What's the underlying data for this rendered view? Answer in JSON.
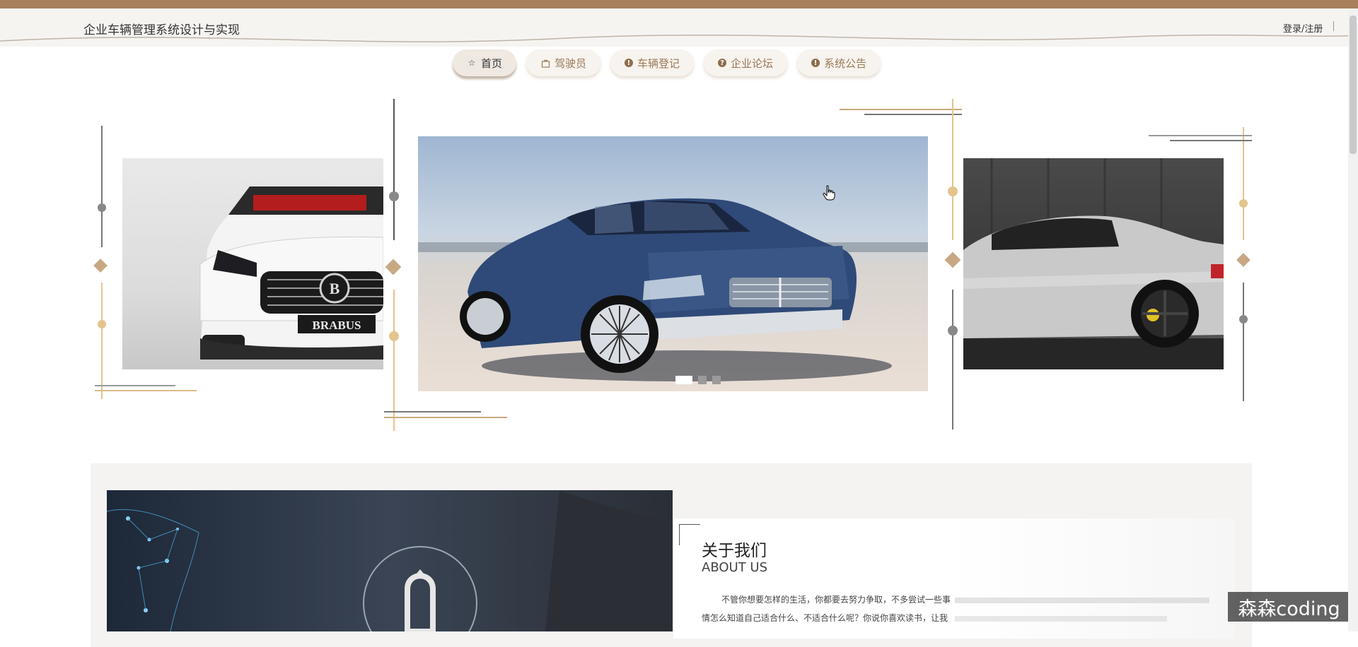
{
  "header": {
    "site_title": "企业车辆管理系统设计与实现",
    "login_label": "登录/注册"
  },
  "nav": {
    "items": [
      {
        "label": "首页",
        "icon": "star-icon",
        "active": true
      },
      {
        "label": "驾驶员",
        "icon": "bag-icon",
        "active": false
      },
      {
        "label": "车辆登记",
        "icon": "info-icon",
        "active": false
      },
      {
        "label": "企业论坛",
        "icon": "question-icon",
        "active": false
      },
      {
        "label": "系统公告",
        "icon": "info-icon",
        "active": false
      }
    ]
  },
  "carousel": {
    "slides": [
      {
        "name": "white-brabus-convertible",
        "position": "left"
      },
      {
        "name": "blue-lincoln-sedan",
        "position": "center"
      },
      {
        "name": "silver-coupe",
        "position": "right"
      }
    ],
    "dots": [
      {
        "active": true
      },
      {
        "active": false
      },
      {
        "active": false
      }
    ],
    "badge_text": "BRABUS"
  },
  "about": {
    "title": "关于我们",
    "subtitle": "ABOUT US",
    "text": "不管你想要怎样的生活，你都要去努力争取，不多尝试一些事情怎么知道自己适合什么、不适合什么呢？你说你喜欢读书，让我给你列书单，你还问我哪里有那么多时间看书"
  },
  "watermark": "森森coding",
  "colors": {
    "accent_brown": "#a7805c",
    "nav_text": "#9a7a58",
    "diamond": "#c7a882"
  }
}
